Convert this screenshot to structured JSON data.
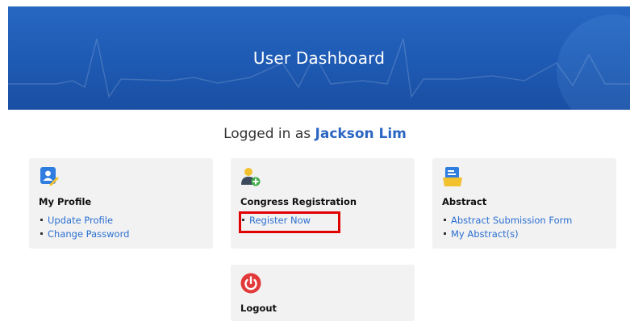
{
  "banner": {
    "title": "User Dashboard"
  },
  "status": {
    "prefix": "Logged in as",
    "user": "Jackson Lim"
  },
  "cards": {
    "profile": {
      "title": "My Profile",
      "icon": "user-profile-icon",
      "links": [
        "Update Profile",
        "Change Password"
      ]
    },
    "registration": {
      "title": "Congress Registration",
      "icon": "add-user-icon",
      "links": [
        "Register Now"
      ]
    },
    "abstract": {
      "title": "Abstract",
      "icon": "document-icon",
      "links": [
        "Abstract Submission Form",
        "My Abstract(s)"
      ]
    },
    "logout": {
      "title": "Logout",
      "icon": "power-icon"
    }
  },
  "colors": {
    "banner": "#1f5cb6",
    "link": "#2b6fd1",
    "card_bg": "#f2f2f2",
    "highlight": "#e00000",
    "logout_icon": "#e23a3a",
    "icon_yellow": "#f2c12e",
    "icon_blue": "#2f7de1",
    "icon_green": "#3fae49"
  }
}
